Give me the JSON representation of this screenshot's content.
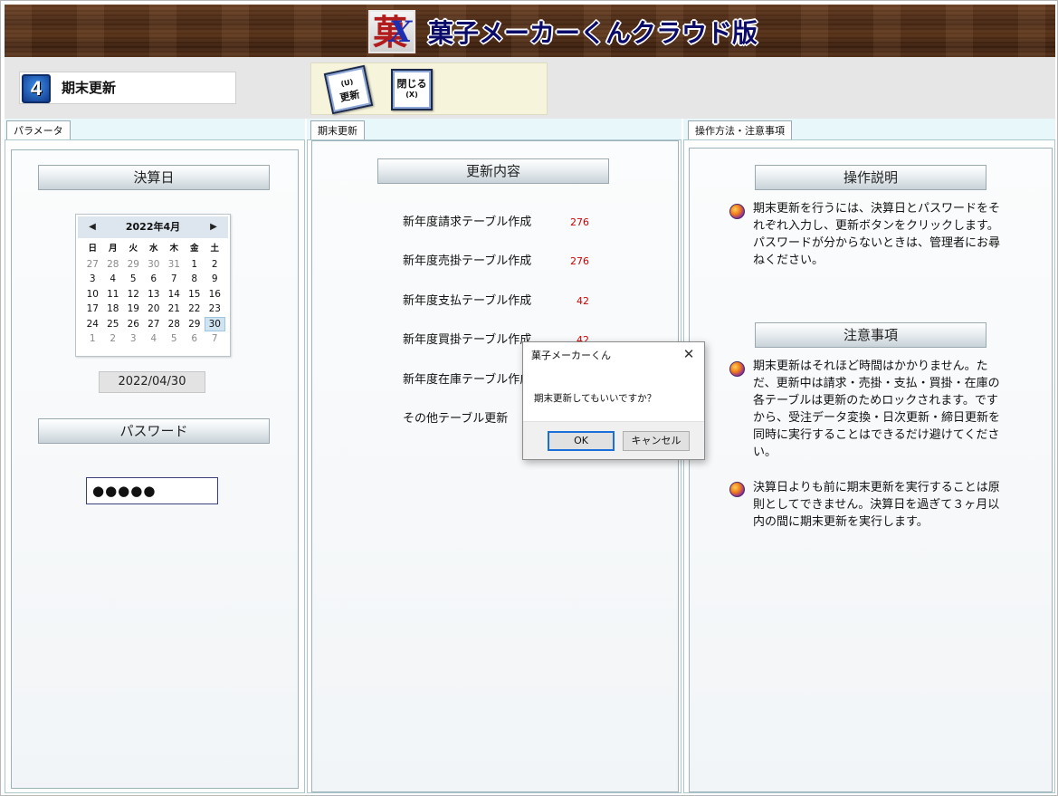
{
  "app": {
    "logo_left": "菓",
    "logo_right": "X",
    "title": "菓子メーカーくんクラウド版"
  },
  "screen": {
    "number": "4",
    "title": "期末更新"
  },
  "toolbar": {
    "update_label": "更新",
    "update_shortcut": "(U)",
    "close_label": "閉じる",
    "close_shortcut": "(X)"
  },
  "tabs": {
    "params": "パラメータ",
    "update": "期末更新",
    "help": "操作方法・注意事項"
  },
  "params": {
    "settlement_header": "決算日",
    "calendar": {
      "month_label": "2022年4月",
      "weekdays": [
        "日",
        "月",
        "火",
        "水",
        "木",
        "金",
        "土"
      ],
      "weeks": [
        [
          "27",
          "28",
          "29",
          "30",
          "31",
          "1",
          "2"
        ],
        [
          "3",
          "4",
          "5",
          "6",
          "7",
          "8",
          "9"
        ],
        [
          "10",
          "11",
          "12",
          "13",
          "14",
          "15",
          "16"
        ],
        [
          "17",
          "18",
          "19",
          "20",
          "21",
          "22",
          "23"
        ],
        [
          "24",
          "25",
          "26",
          "27",
          "28",
          "29",
          "30"
        ],
        [
          "1",
          "2",
          "3",
          "4",
          "5",
          "6",
          "7"
        ]
      ],
      "selected_day": "30"
    },
    "date_value": "2022/04/30",
    "password_header": "パスワード",
    "password_value": "●●●●●"
  },
  "update": {
    "header": "更新内容",
    "rows": [
      {
        "label": "新年度請求テーブル作成",
        "count": "276"
      },
      {
        "label": "新年度売掛テーブル作成",
        "count": "276"
      },
      {
        "label": "新年度支払テーブル作成",
        "count": "42"
      },
      {
        "label": "新年度買掛テーブル作成",
        "count": "42"
      },
      {
        "label": "新年度在庫テーブル作成",
        "count": ""
      },
      {
        "label": "その他テーブル更新",
        "count": ""
      }
    ]
  },
  "help": {
    "instructions_header": "操作説明",
    "instructions": [
      "期末更新を行うには、決算日とパスワードをそれぞれ入力し、更新ボタンをクリックします。パスワードが分からないときは、管理者にお尋ねください。"
    ],
    "notes_header": "注意事項",
    "notes": [
      "期末更新はそれほど時間はかかりません。ただ、更新中は請求・売掛・支払・買掛・在庫の各テーブルは更新のためロックされます。ですから、受注データ変換・日次更新・締日更新を同時に実行することはできるだけ避けてください。",
      "決算日よりも前に期末更新を実行することは原則としてできません。決算日を過ぎて３ヶ月以内の間に期末更新を実行します。"
    ]
  },
  "dialog": {
    "title": "菓子メーカーくん",
    "message": "期末更新してもいいですか？",
    "ok_label": "OK",
    "cancel_label": "キャンセル",
    "close_glyph": "✕"
  },
  "colors": {
    "title_navy": "#0b0b6a",
    "count_red": "#d10000",
    "panel_bg": "#e8f8fa",
    "toolbar_bg": "#e6e6e6",
    "button_group_bg": "#f7f4dc"
  }
}
